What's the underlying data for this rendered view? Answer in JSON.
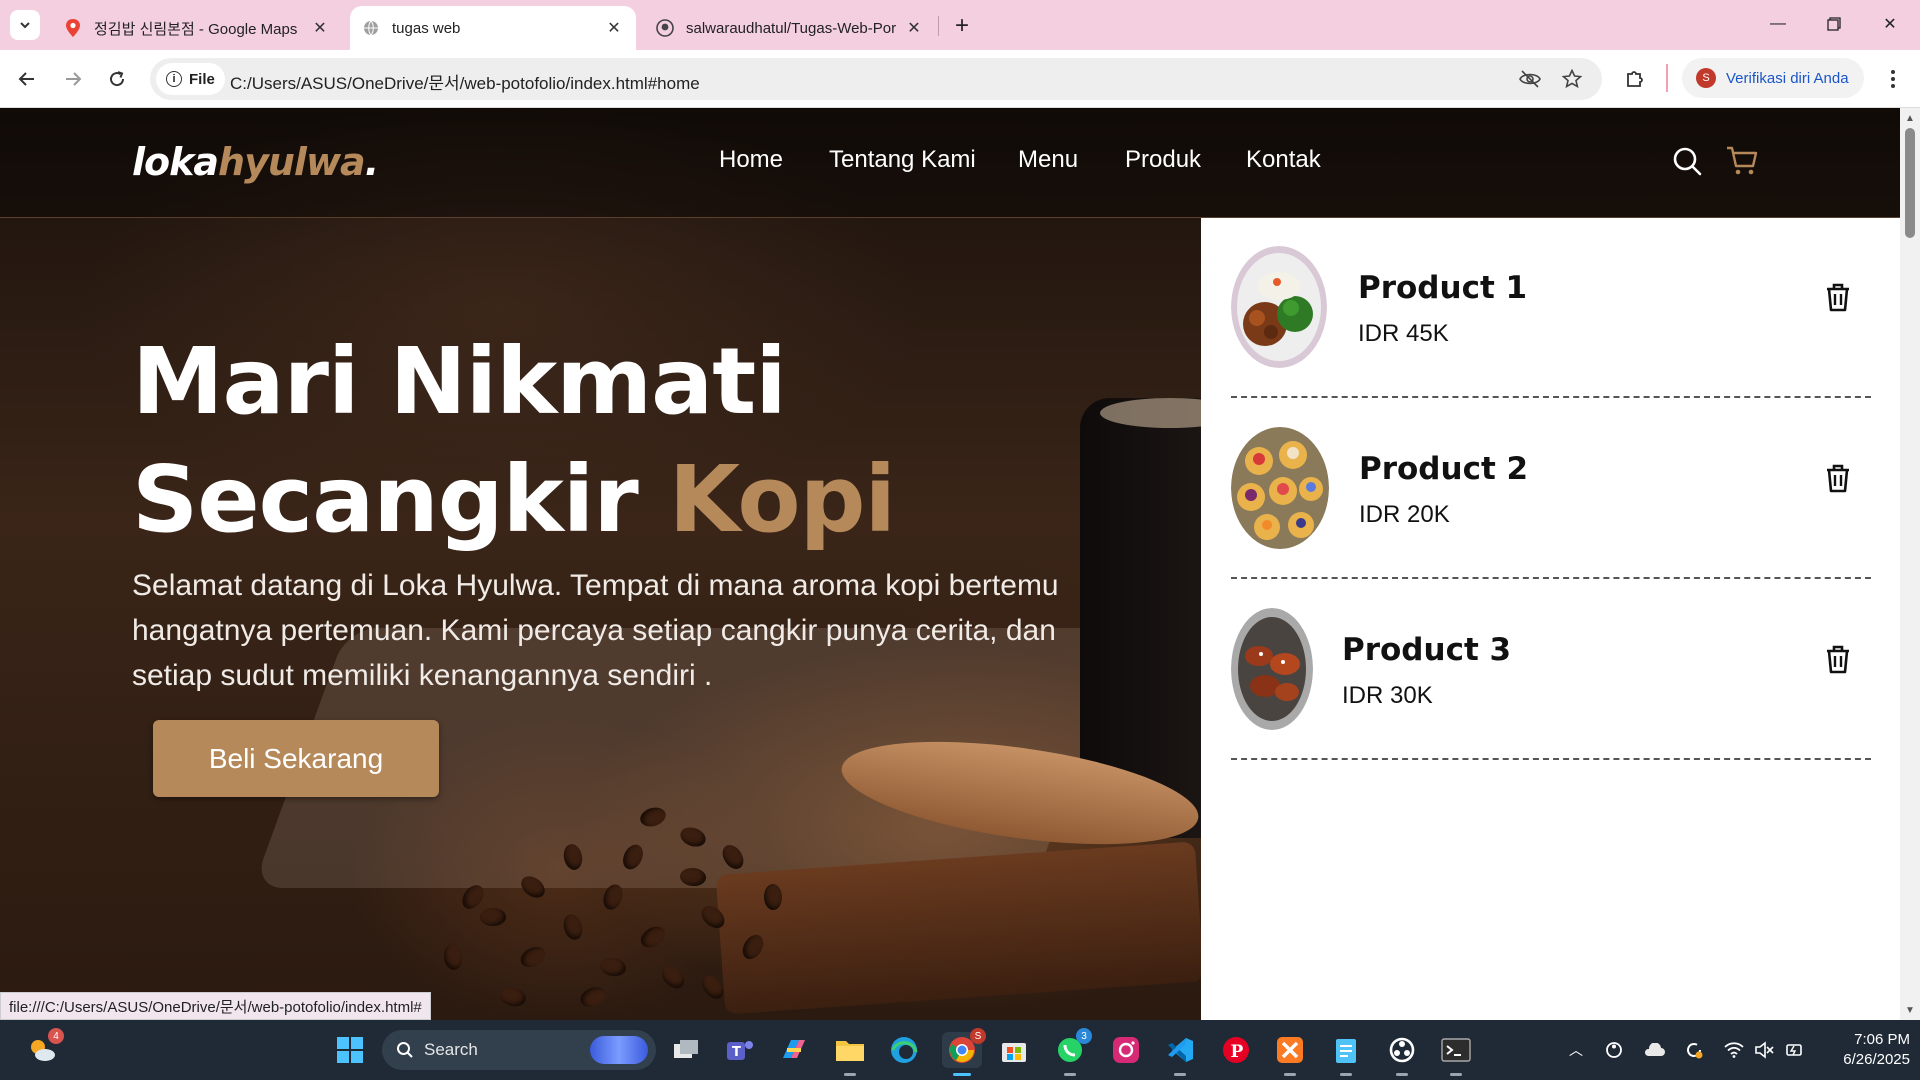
{
  "browser": {
    "tabs": [
      {
        "title": "정김밥 신림본점 - Google Maps",
        "icon": "google-maps-icon"
      },
      {
        "title": "tugas web",
        "icon": "globe-icon",
        "active": true
      },
      {
        "title": "salwaraudhatul/Tugas-Web-Porto",
        "icon": "github-icon"
      }
    ],
    "address": {
      "scheme_label": "File",
      "url": "C:/Users/ASUS/OneDrive/문서/web-potofolio/index.html#home"
    },
    "profile_label": "Verifikasi diri Anda",
    "profile_initial": "S",
    "status_url": "file:///C:/Users/ASUS/OneDrive/문서/web-potofolio/index.html#"
  },
  "site": {
    "logo": {
      "part1": "loka",
      "part2": "hyulwa",
      "dot": "."
    },
    "nav": [
      "Home",
      "Tentang Kami",
      "Menu",
      "Produk",
      "Kontak"
    ],
    "hero": {
      "title_line1": "Mari Nikmati",
      "title_line2_a": "Secangkir ",
      "title_line2_b": "Kopi",
      "description": "Selamat datang di Loka Hyulwa. Tempat di mana aroma kopi bertemu hangatnya pertemuan. Kami percaya setiap cangkir punya cerita, dan setiap sudut memiliki kenangannya sendiri .",
      "cta": "Beli Sekarang"
    },
    "cart": [
      {
        "name": "Product 1",
        "price": "IDR 45K"
      },
      {
        "name": "Product 2",
        "price": "IDR 20K"
      },
      {
        "name": "Product 3",
        "price": "IDR 30K"
      }
    ],
    "colors": {
      "accent": "#b6895b",
      "navbar_text": "#ffffff"
    }
  },
  "taskbar": {
    "search_placeholder": "Search",
    "weather_badge": "4",
    "chrome_badge": "S",
    "whatsapp_badge": "3",
    "time": "7:06 PM",
    "date": "6/26/2025"
  }
}
